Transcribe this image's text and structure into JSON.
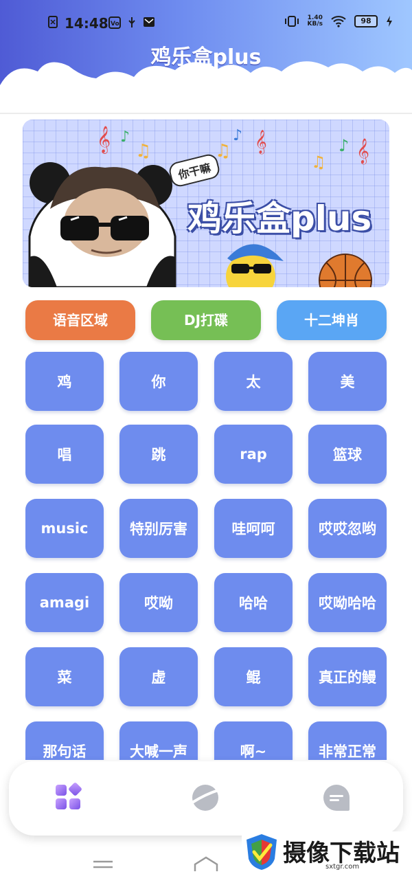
{
  "status_bar": {
    "time": "14:48",
    "speed_value": "1.40",
    "speed_unit": "KB/s",
    "battery": "98"
  },
  "header": {
    "title": "鸡乐盒plus"
  },
  "banner": {
    "bubble_text": "你干嘛",
    "title": "鸡乐盒plus"
  },
  "categories": [
    {
      "label": "语音区域",
      "color": "#ea7a45"
    },
    {
      "label": "DJ打碟",
      "color": "#76bf55"
    },
    {
      "label": "十二坤肖",
      "color": "#5aa6f4"
    }
  ],
  "sounds": [
    "鸡",
    "你",
    "太",
    "美",
    "唱",
    "跳",
    "rap",
    "篮球",
    "music",
    "特别厉害",
    "哇呵呵",
    "哎哎忽哟",
    "amagi",
    "哎呦",
    "哈哈",
    "哎呦哈哈",
    "菜",
    "虚",
    "鲲",
    "真正的鳗",
    "那句话",
    "大喊一声",
    "啊~",
    "非常正常"
  ],
  "nav": [
    {
      "icon": "grid-icon",
      "active": true
    },
    {
      "icon": "planet-icon",
      "active": false
    },
    {
      "icon": "chat-icon",
      "active": false
    }
  ],
  "watermark": {
    "text": "摄像下载站",
    "url": "sxtgr.com"
  },
  "colors": {
    "accent": "#6e8cee",
    "header_start": "#4f5bd5",
    "header_end": "#9fc7ff"
  }
}
